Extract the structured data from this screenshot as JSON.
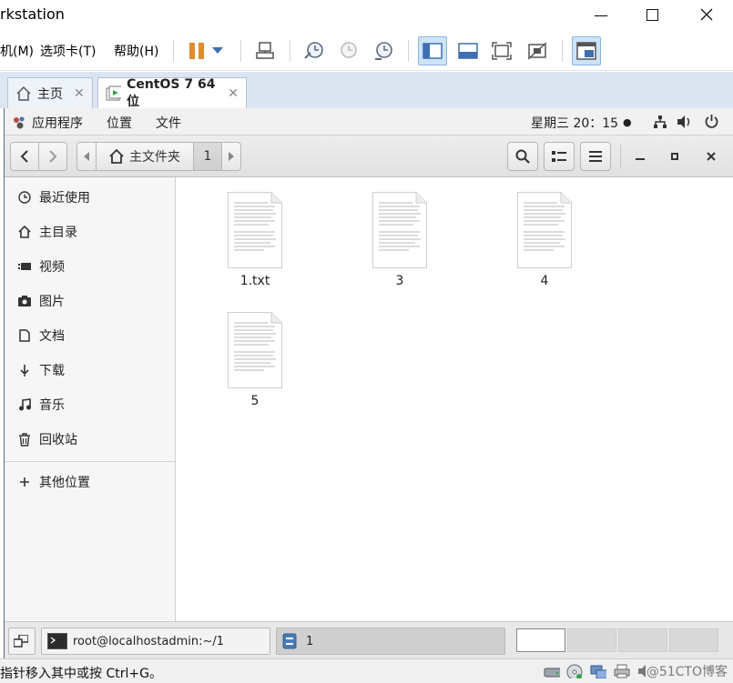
{
  "host": {
    "title": "rkstation",
    "menu": [
      "机(M)",
      "选项卡(T)",
      "帮助(H)"
    ],
    "tabs": [
      {
        "label": "主页",
        "icon": "home-icon"
      },
      {
        "label": "CentOS 7 64 位",
        "icon": "vm-icon"
      }
    ],
    "status_message": "指针移入其中或按 Ctrl+G。",
    "watermark": "@51CTO博客"
  },
  "gnome": {
    "applications": "应用程序",
    "places": "位置",
    "files": "文件",
    "clock": "星期三 20：15",
    "clock_dot": "●"
  },
  "nautilus": {
    "path_home": "主文件夹",
    "path_current": "1"
  },
  "sidebar": {
    "items": [
      {
        "label": "最近使用",
        "icon": "clock-icon"
      },
      {
        "label": "主目录",
        "icon": "home-icon"
      },
      {
        "label": "视频",
        "icon": "video-icon"
      },
      {
        "label": "图片",
        "icon": "camera-icon"
      },
      {
        "label": "文档",
        "icon": "document-icon"
      },
      {
        "label": "下载",
        "icon": "download-icon"
      },
      {
        "label": "音乐",
        "icon": "music-icon"
      },
      {
        "label": "回收站",
        "icon": "trash-icon"
      }
    ],
    "other_locations": "其他位置"
  },
  "files": [
    {
      "name": "1.txt"
    },
    {
      "name": "3"
    },
    {
      "name": "4"
    },
    {
      "name": "5"
    }
  ],
  "taskbar": {
    "terminal": "root@localhostadmin:~/1",
    "files_window": "1"
  },
  "colors": {
    "accent": "#3f7ac2",
    "tab_bar": "#dce6f3",
    "pause": "#e08b2c"
  }
}
